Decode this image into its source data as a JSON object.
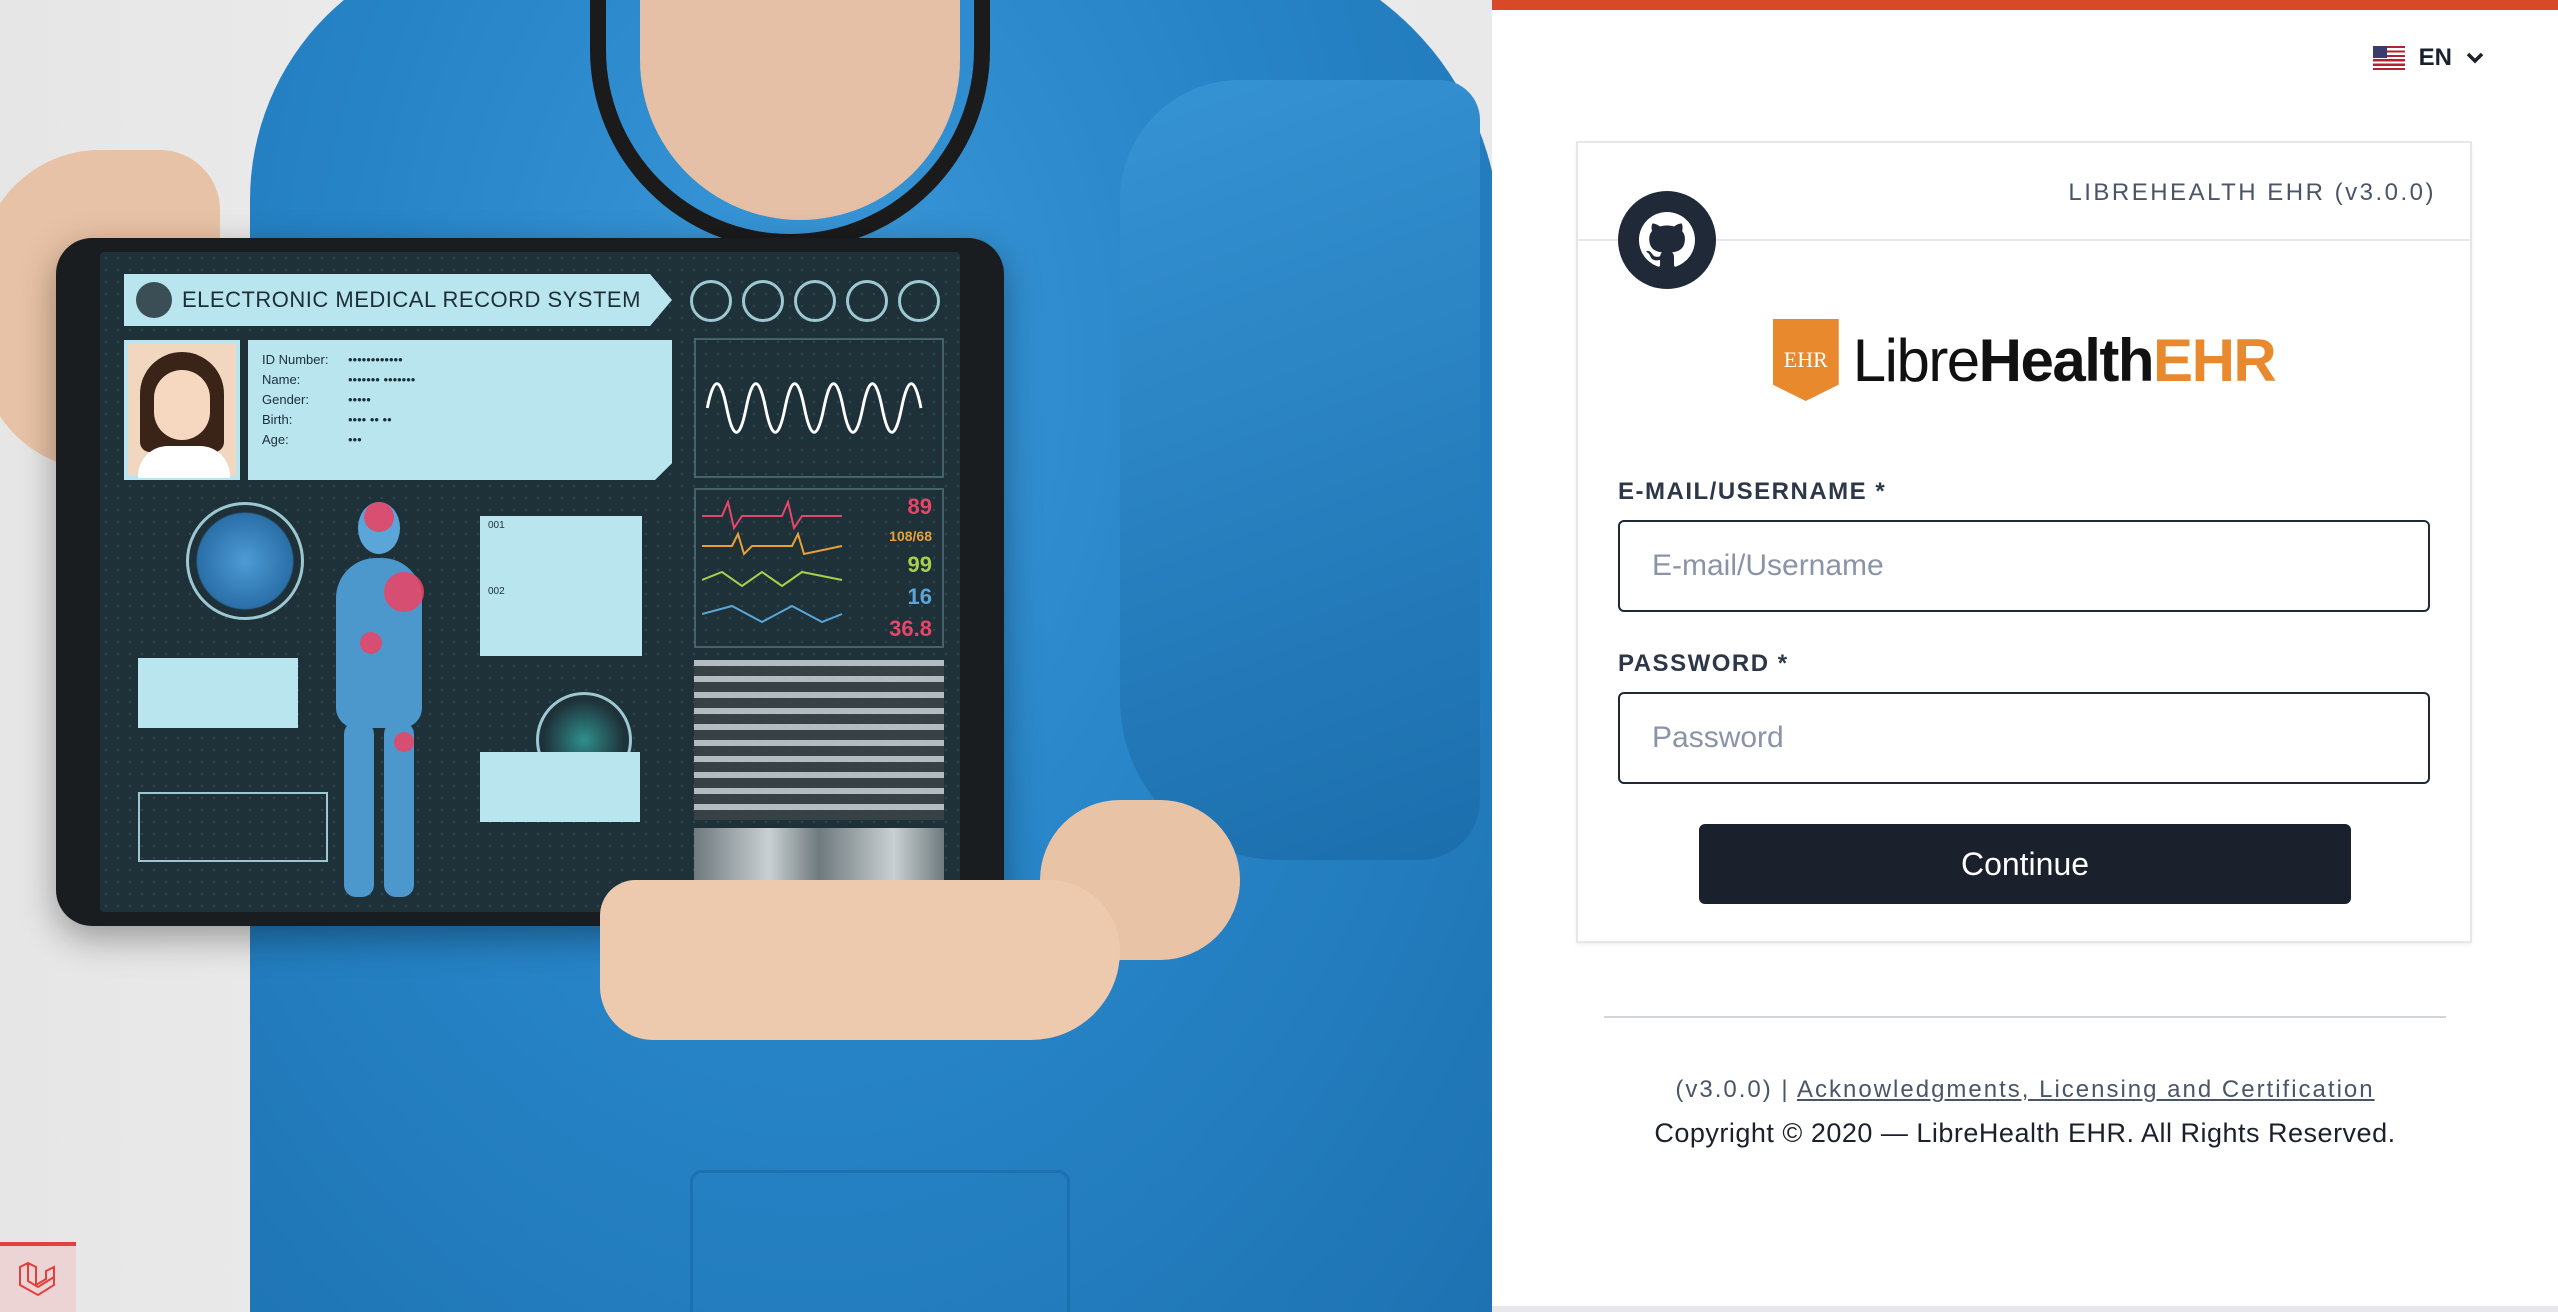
{
  "hero": {
    "screen_title": "ELECTRONIC MEDICAL RECORD SYSTEM",
    "patient_fields": [
      {
        "label": "ID Number:",
        "value": "••••••••••••"
      },
      {
        "label": "Name:",
        "value": "••••••• •••••••"
      },
      {
        "label": "Gender:",
        "value": "•••••"
      },
      {
        "label": "Birth:",
        "value": "•••• •• ••"
      },
      {
        "label": "Age:",
        "value": "•••"
      }
    ],
    "vitals": [
      "89",
      "108/68",
      "99",
      "16",
      "36.8"
    ],
    "note_labels": [
      "001",
      "002"
    ],
    "colors": {
      "scrubs": "#2785c8",
      "screen_panel": "#b9e5ee",
      "accent_red": "#e64667"
    }
  },
  "language": {
    "code": "EN",
    "flag_icon": "us-flag-icon",
    "chevron_icon": "chevron-down-icon"
  },
  "card": {
    "version_label": "LIBREHEALTH EHR (v3.0.0)",
    "github_icon": "github-icon",
    "logo": {
      "badge": "EHR",
      "part1": "Libre",
      "part2": "Health",
      "part3": "EHR"
    },
    "email": {
      "label": "E-MAIL/USERNAME *",
      "placeholder": "E-mail/Username",
      "value": ""
    },
    "password": {
      "label": "PASSWORD *",
      "placeholder": "Password",
      "value": ""
    },
    "continue_label": "Continue"
  },
  "footer": {
    "version": "(v3.0.0) |",
    "link_text": "Acknowledgments, Licensing and Certification",
    "copyright": "Copyright © 2020 — LibreHealth EHR. All Rights Reserved."
  },
  "colors": {
    "top_bar": "#d84a27",
    "button": "#1a202c",
    "brand_orange": "#e8892e"
  }
}
